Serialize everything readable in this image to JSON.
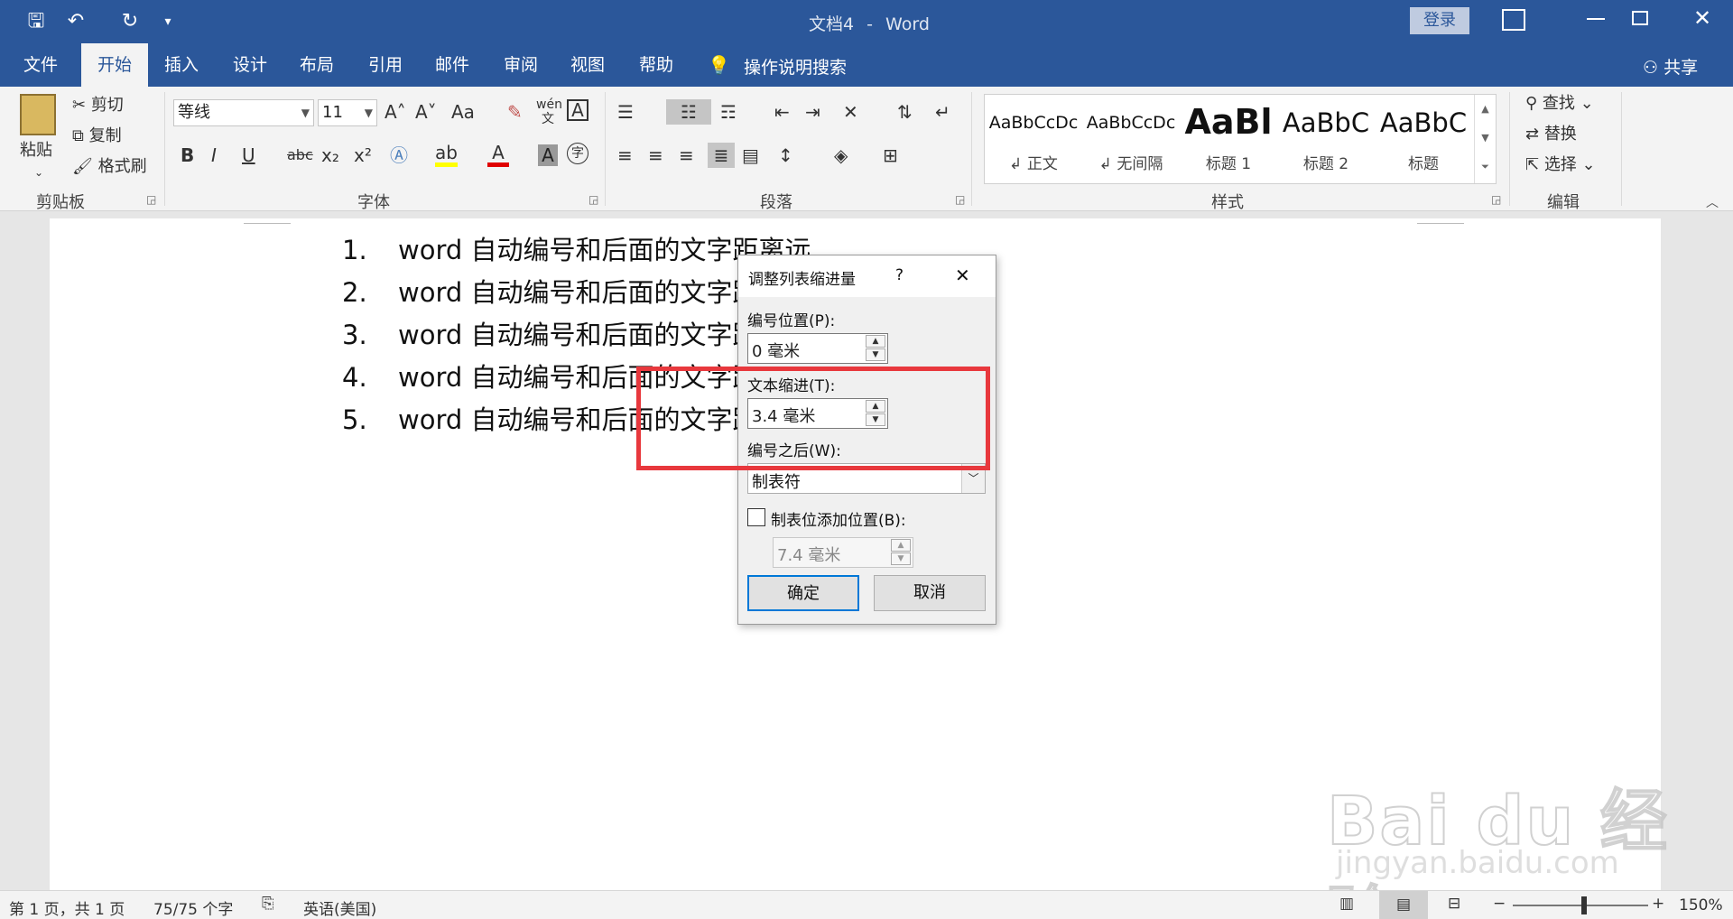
{
  "titlebar": {
    "doc_title": "文档4",
    "separator": "-",
    "app": "Word",
    "login": "登录",
    "qat_undo": "↶",
    "qat_redo": "↻",
    "qat_more": "▾"
  },
  "tabs": [
    "文件",
    "开始",
    "插入",
    "设计",
    "布局",
    "引用",
    "邮件",
    "审阅",
    "视图",
    "帮助"
  ],
  "tell_me": "操作说明搜索",
  "share": "共享",
  "clipboard": {
    "paste": "粘贴",
    "cut": "剪切",
    "copy": "复制",
    "painter": "格式刷",
    "label": "剪贴板"
  },
  "font": {
    "name": "等线",
    "size": "11",
    "label": "字体",
    "bold": "B",
    "italic": "I",
    "underline": "U",
    "strike": "abc",
    "sub": "x₂",
    "sup": "x²",
    "grow": "A˄",
    "shrink": "A˅",
    "case": "Aa",
    "clear": "✎",
    "phonetic": "wén 文",
    "border_char": "A",
    "highlight": "ab",
    "color": "A",
    "shade": "A",
    "enclose": "字"
  },
  "paragraph": {
    "label": "段落"
  },
  "styles": {
    "label": "样式",
    "items": [
      {
        "sample": "AaBbCcDc",
        "name": "↲ 正文"
      },
      {
        "sample": "AaBbCcDc",
        "name": "↲ 无间隔"
      },
      {
        "sample": "AaBl",
        "name": "标题 1"
      },
      {
        "sample": "AaBbC",
        "name": "标题 2"
      },
      {
        "sample": "AaBbC",
        "name": "标题"
      }
    ]
  },
  "editing": {
    "find": "查找",
    "replace": "替换",
    "select": "选择",
    "label": "编辑"
  },
  "document": {
    "items": [
      {
        "num": "1.",
        "text": "word 自动编号和后面的文字距离远"
      },
      {
        "num": "2.",
        "text": "word 自动编号和后面的文字距"
      },
      {
        "num": "3.",
        "text": "word 自动编号和后面的文字距"
      },
      {
        "num": "4.",
        "text": "word 自动编号和后面的文字距"
      },
      {
        "num": "5.",
        "text": "word 自动编号和后面的文字距"
      }
    ]
  },
  "dialog": {
    "title": "调整列表缩进量",
    "help": "?",
    "close": "✕",
    "number_position_label": "编号位置(P):",
    "number_position_value": "0 毫米",
    "text_indent_label": "文本缩进(T):",
    "text_indent_value": "3.4 毫米",
    "follow_label": "编号之后(W):",
    "follow_value": "制表符",
    "tab_add_label": "制表位添加位置(B):",
    "tab_add_value": "7.4 毫米",
    "ok": "确定",
    "cancel": "取消"
  },
  "status": {
    "page": "第 1 页，共 1 页",
    "words": "75/75 个字",
    "language": "英语(美国)",
    "zoom": "150%"
  },
  "watermark": {
    "brand": "Bai du 经验",
    "url": "jingyan.baidu.com"
  },
  "colors": {
    "accent": "#2b579a",
    "highlight_box": "#e8383d"
  }
}
